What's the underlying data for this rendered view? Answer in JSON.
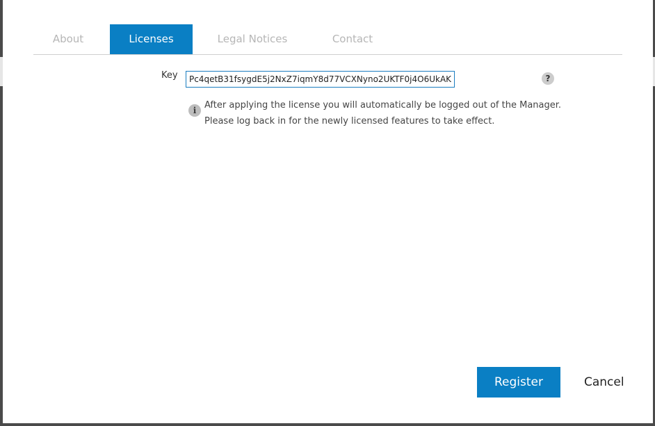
{
  "tabs": {
    "about": "About",
    "licenses": "Licenses",
    "legal": "Legal Notices",
    "contact": "Contact",
    "active": "Licenses"
  },
  "license": {
    "key_label": "Key",
    "key_value": "Pc4qetB31fsygdE5j2NxZ7iqmY8d77VCXNyno2UKTF0j4O6UkAK",
    "help_glyph": "?",
    "info_glyph": "i",
    "info_line1": "After applying the license you will automatically be logged out of the Manager.",
    "info_line2": "Please log back in for the newly licensed features to take effect."
  },
  "actions": {
    "register_label": "Register",
    "cancel_label": "Cancel"
  },
  "colors": {
    "accent": "#0a7fc4",
    "tab_inactive": "#b6b6b6"
  },
  "icons": {
    "help": "question-circle-icon",
    "info": "info-circle-icon"
  }
}
